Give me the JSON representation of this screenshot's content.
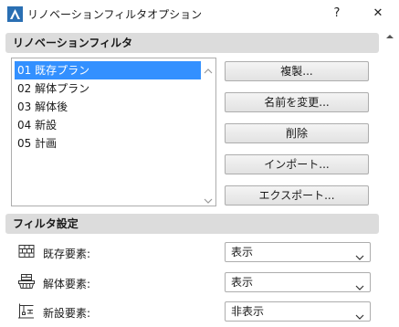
{
  "window": {
    "title": "リノベーションフィルタオプション",
    "help_label": "?",
    "close_label": "✕"
  },
  "filters_section": {
    "header": "リノベーションフィルタ",
    "items": [
      {
        "label": "01 既存プラン",
        "selected": true
      },
      {
        "label": "02 解体プラン",
        "selected": false
      },
      {
        "label": "03 解体後",
        "selected": false
      },
      {
        "label": "04 新設",
        "selected": false
      },
      {
        "label": "05 計画",
        "selected": false
      }
    ],
    "buttons": {
      "duplicate": "複製...",
      "rename": "名前を変更...",
      "delete": "削除",
      "import": "インポート...",
      "export": "エクスポート..."
    }
  },
  "settings_section": {
    "header": "フィルタ設定",
    "rows": [
      {
        "label": "既存要素:",
        "value": "表示",
        "icon": "existing-wall-icon"
      },
      {
        "label": "解体要素:",
        "value": "表示",
        "icon": "demolish-icon"
      },
      {
        "label": "新設要素:",
        "value": "非表示",
        "icon": "new-construction-icon"
      }
    ]
  },
  "colors": {
    "selection": "#3390ff",
    "section_bg": "#dcdcdc",
    "app_icon": "#2a6fb3"
  }
}
